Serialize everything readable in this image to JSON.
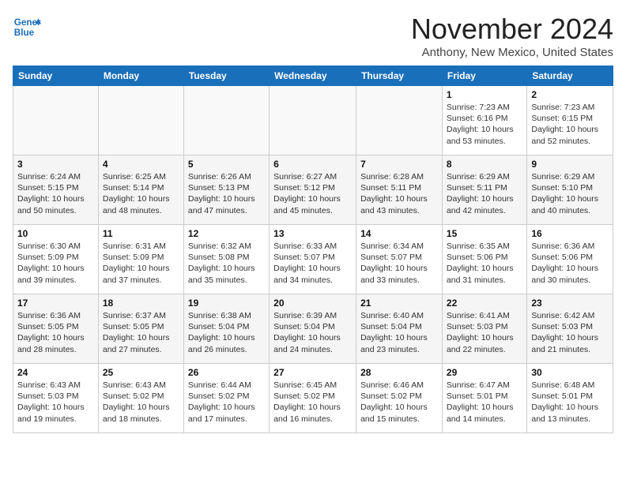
{
  "header": {
    "logo_line1": "General",
    "logo_line2": "Blue",
    "title": "November 2024",
    "subtitle": "Anthony, New Mexico, United States"
  },
  "weekdays": [
    "Sunday",
    "Monday",
    "Tuesday",
    "Wednesday",
    "Thursday",
    "Friday",
    "Saturday"
  ],
  "weeks": [
    [
      {
        "day": "",
        "info": ""
      },
      {
        "day": "",
        "info": ""
      },
      {
        "day": "",
        "info": ""
      },
      {
        "day": "",
        "info": ""
      },
      {
        "day": "",
        "info": ""
      },
      {
        "day": "1",
        "info": "Sunrise: 7:23 AM\nSunset: 6:16 PM\nDaylight: 10 hours and 53 minutes."
      },
      {
        "day": "2",
        "info": "Sunrise: 7:23 AM\nSunset: 6:15 PM\nDaylight: 10 hours and 52 minutes."
      }
    ],
    [
      {
        "day": "3",
        "info": "Sunrise: 6:24 AM\nSunset: 5:15 PM\nDaylight: 10 hours and 50 minutes."
      },
      {
        "day": "4",
        "info": "Sunrise: 6:25 AM\nSunset: 5:14 PM\nDaylight: 10 hours and 48 minutes."
      },
      {
        "day": "5",
        "info": "Sunrise: 6:26 AM\nSunset: 5:13 PM\nDaylight: 10 hours and 47 minutes."
      },
      {
        "day": "6",
        "info": "Sunrise: 6:27 AM\nSunset: 5:12 PM\nDaylight: 10 hours and 45 minutes."
      },
      {
        "day": "7",
        "info": "Sunrise: 6:28 AM\nSunset: 5:11 PM\nDaylight: 10 hours and 43 minutes."
      },
      {
        "day": "8",
        "info": "Sunrise: 6:29 AM\nSunset: 5:11 PM\nDaylight: 10 hours and 42 minutes."
      },
      {
        "day": "9",
        "info": "Sunrise: 6:29 AM\nSunset: 5:10 PM\nDaylight: 10 hours and 40 minutes."
      }
    ],
    [
      {
        "day": "10",
        "info": "Sunrise: 6:30 AM\nSunset: 5:09 PM\nDaylight: 10 hours and 39 minutes."
      },
      {
        "day": "11",
        "info": "Sunrise: 6:31 AM\nSunset: 5:09 PM\nDaylight: 10 hours and 37 minutes."
      },
      {
        "day": "12",
        "info": "Sunrise: 6:32 AM\nSunset: 5:08 PM\nDaylight: 10 hours and 35 minutes."
      },
      {
        "day": "13",
        "info": "Sunrise: 6:33 AM\nSunset: 5:07 PM\nDaylight: 10 hours and 34 minutes."
      },
      {
        "day": "14",
        "info": "Sunrise: 6:34 AM\nSunset: 5:07 PM\nDaylight: 10 hours and 33 minutes."
      },
      {
        "day": "15",
        "info": "Sunrise: 6:35 AM\nSunset: 5:06 PM\nDaylight: 10 hours and 31 minutes."
      },
      {
        "day": "16",
        "info": "Sunrise: 6:36 AM\nSunset: 5:06 PM\nDaylight: 10 hours and 30 minutes."
      }
    ],
    [
      {
        "day": "17",
        "info": "Sunrise: 6:36 AM\nSunset: 5:05 PM\nDaylight: 10 hours and 28 minutes."
      },
      {
        "day": "18",
        "info": "Sunrise: 6:37 AM\nSunset: 5:05 PM\nDaylight: 10 hours and 27 minutes."
      },
      {
        "day": "19",
        "info": "Sunrise: 6:38 AM\nSunset: 5:04 PM\nDaylight: 10 hours and 26 minutes."
      },
      {
        "day": "20",
        "info": "Sunrise: 6:39 AM\nSunset: 5:04 PM\nDaylight: 10 hours and 24 minutes."
      },
      {
        "day": "21",
        "info": "Sunrise: 6:40 AM\nSunset: 5:04 PM\nDaylight: 10 hours and 23 minutes."
      },
      {
        "day": "22",
        "info": "Sunrise: 6:41 AM\nSunset: 5:03 PM\nDaylight: 10 hours and 22 minutes."
      },
      {
        "day": "23",
        "info": "Sunrise: 6:42 AM\nSunset: 5:03 PM\nDaylight: 10 hours and 21 minutes."
      }
    ],
    [
      {
        "day": "24",
        "info": "Sunrise: 6:43 AM\nSunset: 5:03 PM\nDaylight: 10 hours and 19 minutes."
      },
      {
        "day": "25",
        "info": "Sunrise: 6:43 AM\nSunset: 5:02 PM\nDaylight: 10 hours and 18 minutes."
      },
      {
        "day": "26",
        "info": "Sunrise: 6:44 AM\nSunset: 5:02 PM\nDaylight: 10 hours and 17 minutes."
      },
      {
        "day": "27",
        "info": "Sunrise: 6:45 AM\nSunset: 5:02 PM\nDaylight: 10 hours and 16 minutes."
      },
      {
        "day": "28",
        "info": "Sunrise: 6:46 AM\nSunset: 5:02 PM\nDaylight: 10 hours and 15 minutes."
      },
      {
        "day": "29",
        "info": "Sunrise: 6:47 AM\nSunset: 5:01 PM\nDaylight: 10 hours and 14 minutes."
      },
      {
        "day": "30",
        "info": "Sunrise: 6:48 AM\nSunset: 5:01 PM\nDaylight: 10 hours and 13 minutes."
      }
    ]
  ]
}
